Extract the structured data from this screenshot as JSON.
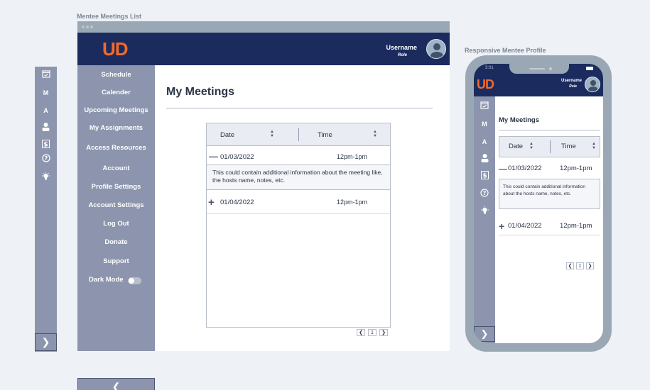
{
  "captions": {
    "list": "Mentee Meetings List",
    "profile": "Responsive Mentee Profile"
  },
  "rail": {
    "letters": [
      "M",
      "A"
    ]
  },
  "header": {
    "logo": "UD",
    "username": "Username",
    "role": "Role"
  },
  "sidebar": {
    "items": [
      "Schedule",
      "Calender",
      "Upcoming Meetings",
      "My Assignments",
      "Access Resources",
      "Account",
      "Profile Settings",
      "Account Settings",
      "Log Out",
      "Donate",
      "Support"
    ],
    "dark_mode_label": "Dark Mode",
    "dark_mode_on": false
  },
  "main": {
    "title": "My Meetings",
    "table": {
      "columns": [
        "Date",
        "Time"
      ],
      "rows": [
        {
          "date": "01/03/2022",
          "time": "12pm-1pm",
          "expanded": true,
          "detail": "This could contain additional information about the meeting like, the hosts name, notes, etc."
        },
        {
          "date": "01/04/2022",
          "time": "12pm-1pm",
          "expanded": false
        }
      ],
      "page": "1"
    }
  },
  "phone": {
    "status_time": "3:01",
    "username": "Username",
    "role": "Role",
    "letters": [
      "M",
      "A"
    ],
    "title": "My Meetings",
    "columns": [
      "Date",
      "Time"
    ],
    "rows": [
      {
        "date": "01/03/2022",
        "time": "12pm-1pm",
        "detail": "This could contain additional information about the hosts name, notes, etc."
      },
      {
        "date": "01/04/2022",
        "time": "12pm-1pm"
      }
    ],
    "page": "1"
  },
  "colors": {
    "navy": "#1c2b5e",
    "sidebar": "#8c95ad",
    "accent": "#f26a2b",
    "background": "#eef1f5"
  }
}
